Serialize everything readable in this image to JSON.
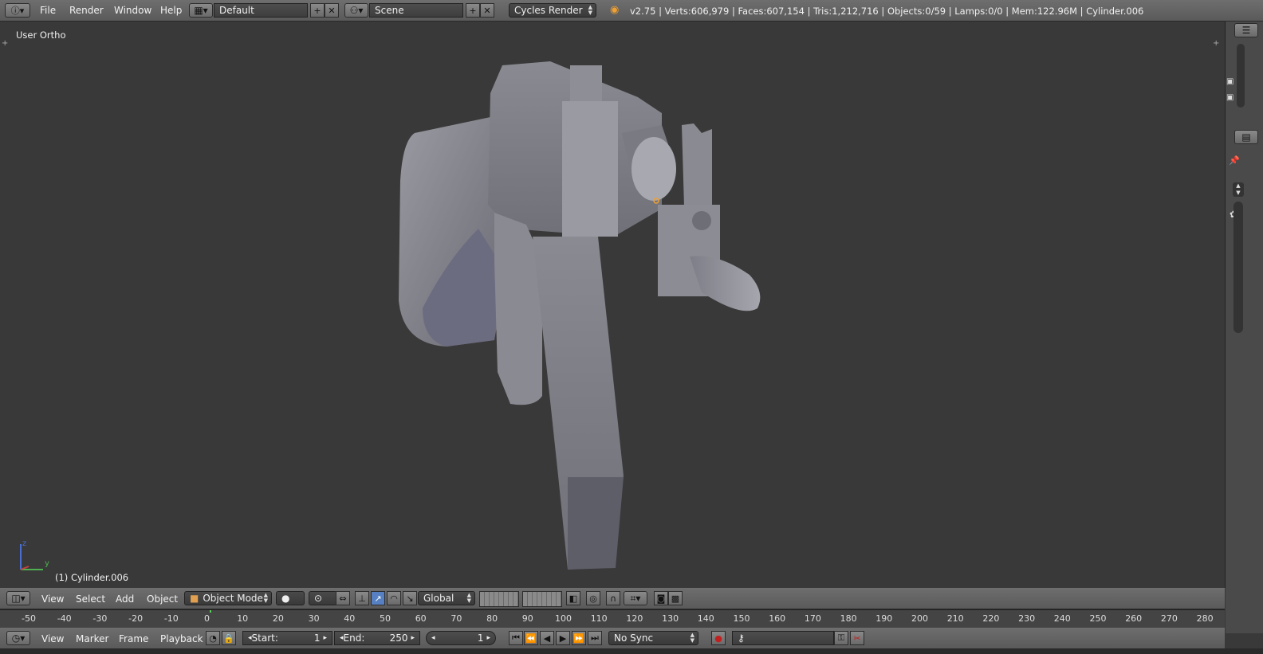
{
  "topbar": {
    "menu": [
      "File",
      "Render",
      "Window",
      "Help"
    ],
    "screen_layout": "Default",
    "scene": "Scene",
    "render_engine": "Cycles Render",
    "stats": "v2.75 | Verts:606,979 | Faces:607,154 | Tris:1,212,716 | Objects:0/59 | Lamps:0/0 | Mem:122.96M | Cylinder.006"
  },
  "viewport": {
    "view_label": "User Ortho",
    "object_label": "(1) Cylinder.006",
    "axis_z": "z",
    "axis_y": "y"
  },
  "viewport_header": {
    "menu": [
      "View",
      "Select",
      "Add",
      "Object"
    ],
    "mode": "Object Mode",
    "orientation": "Global"
  },
  "timeline": {
    "ticks": [
      "-50",
      "-40",
      "-30",
      "-20",
      "-10",
      "0",
      "10",
      "20",
      "30",
      "40",
      "50",
      "60",
      "70",
      "80",
      "90",
      "100",
      "110",
      "120",
      "130",
      "140",
      "150",
      "160",
      "170",
      "180",
      "190",
      "200",
      "210",
      "220",
      "230",
      "240",
      "250",
      "260",
      "270",
      "280"
    ]
  },
  "timeline_header": {
    "menu": [
      "View",
      "Marker",
      "Frame",
      "Playback"
    ],
    "start_label": "Start:",
    "start_value": "1",
    "end_label": "End:",
    "end_value": "250",
    "current_frame": "1",
    "sync": "No Sync"
  },
  "colors": {
    "viewport_bg": "#393939",
    "header_bg": "#5f5f5f",
    "model": "#8a8a93",
    "active_blue": "#5680c2"
  }
}
